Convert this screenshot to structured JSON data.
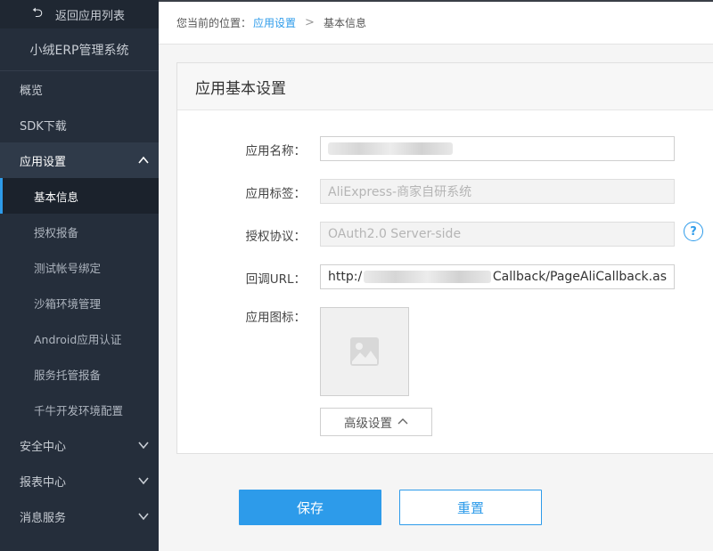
{
  "sidebar": {
    "back_label": "返回应用列表",
    "app_title": "小绒ERP管理系统",
    "overview": "概览",
    "sdk": "SDK下载",
    "app_settings": "应用设置",
    "sub_items": [
      "基本信息",
      "授权报备",
      "测试帐号绑定",
      "沙箱环境管理",
      "Android应用认证",
      "服务托管报备",
      "千牛开发环境配置"
    ],
    "security": "安全中心",
    "reports": "报表中心",
    "messages": "消息服务"
  },
  "breadcrumb": {
    "prefix": "您当前的位置：",
    "link": "应用设置",
    "separator": ">",
    "current": "基本信息"
  },
  "panel": {
    "title": "应用基本设置",
    "app_name_label": "应用名称：",
    "app_tag_label": "应用标签：",
    "app_tag_value": "AliExpress-商家自研系统",
    "auth_label": "授权协议：",
    "auth_value": "OAuth2.0 Server-side",
    "callback_label": "回调URL：",
    "callback_prefix": "http:/",
    "callback_suffix": "Callback/PageAliCallback.as",
    "icon_label": "应用图标：",
    "advanced_label": "高级设置",
    "help_glyph": "?"
  },
  "actions": {
    "save": "保存",
    "reset": "重置"
  },
  "colors": {
    "accent": "#2d9bea",
    "sidebar_bg": "#252e3b"
  },
  "icons": [
    "back-arrow-icon",
    "chevron-up-icon",
    "chevron-down-icon",
    "help-icon",
    "image-placeholder-icon",
    "breadcrumb-separator"
  ]
}
